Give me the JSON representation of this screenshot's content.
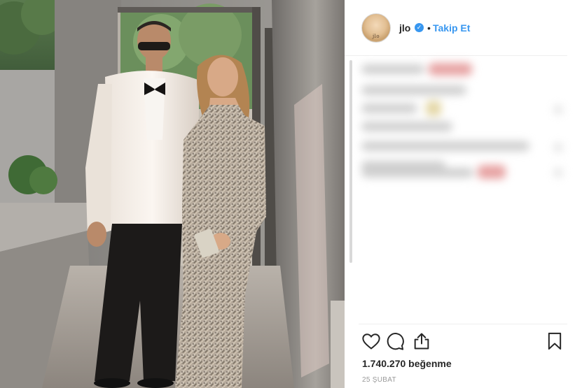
{
  "post": {
    "photo_alt": "Couple posing in formal wear",
    "header": {
      "username": "jlo",
      "verified_symbol": "✓",
      "separator": "•",
      "follow_label": "Takip Et",
      "avatar_text": "jlo"
    },
    "actions": {
      "like_icon": "heart-icon",
      "comment_icon": "comment-bubble-icon",
      "share_icon": "share-upload-icon",
      "save_icon": "bookmark-icon"
    },
    "likes_text": "1.740.270 beğenme",
    "date_text": "25 ŞUBAT"
  },
  "colors": {
    "link_blue": "#3897f0",
    "text_primary": "#262626",
    "text_secondary": "#999999",
    "border": "#efefef"
  }
}
